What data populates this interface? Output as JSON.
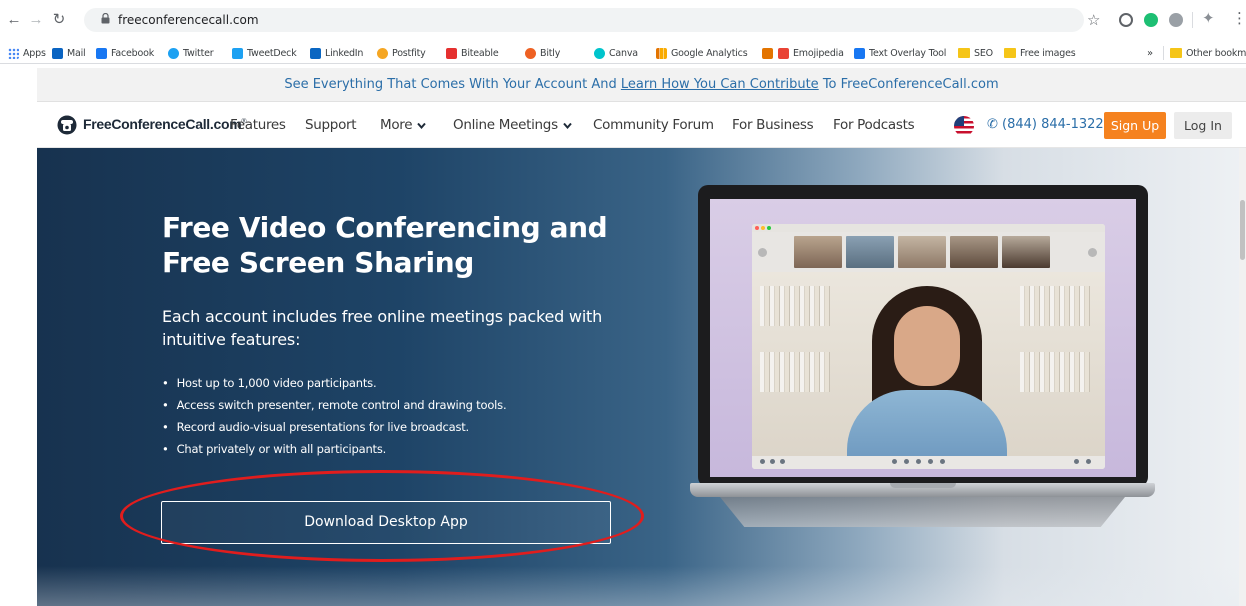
{
  "browser": {
    "url": "freeconferencecall.com",
    "bookmarks": [
      {
        "label": "Apps",
        "color": "#4285f4"
      },
      {
        "label": "Mail",
        "color": "#0a64c2"
      },
      {
        "label": "Facebook",
        "color": "#1877f2"
      },
      {
        "label": "Twitter",
        "color": "#1da1f2"
      },
      {
        "label": "TweetDeck",
        "color": "#1da1f2"
      },
      {
        "label": "LinkedIn",
        "color": "#0a66c2"
      },
      {
        "label": "Postfity",
        "color": "#f5a623"
      },
      {
        "label": "Biteable",
        "color": "#e5302f"
      },
      {
        "label": "Bitly",
        "color": "#ee6123"
      },
      {
        "label": "Canva",
        "color": "#00c4cc"
      },
      {
        "label": "Google Analytics",
        "color": "#f9ab00"
      },
      {
        "label": "",
        "color": "#e37400"
      },
      {
        "label": "Emojipedia",
        "color": "#e94335"
      },
      {
        "label": "Text Overlay Tool",
        "color": "#1877f2"
      },
      {
        "label": "SEO",
        "color": "#f5c518"
      },
      {
        "label": "Free images",
        "color": "#f5c518"
      }
    ],
    "more_bookmarks": "»",
    "other_bookmarks": "Other bookmarks"
  },
  "announcement": {
    "prefix": "See Everything That Comes With Your Account And ",
    "link": "Learn How You Can Contribute",
    "suffix": " To FreeConferenceCall.com"
  },
  "nav": {
    "logo": "FreeConferenceCall.com",
    "logo_mark": "®",
    "links": [
      "Features",
      "Support",
      "More",
      "Online Meetings",
      "Community Forum",
      "For Business",
      "For Podcasts"
    ],
    "phone": "(844) 844-1322",
    "signup": "Sign Up",
    "login": "Log In"
  },
  "hero": {
    "title": "Free Video Conferencing and Free Screen Sharing",
    "subtitle": "Each account includes free online meetings packed with intuitive features:",
    "features": [
      "Host up to 1,000 video participants.",
      "Access switch presenter, remote control and drawing tools.",
      "Record audio-visual presentations for live broadcast.",
      "Chat privately or with all participants."
    ],
    "cta": "Download Desktop App"
  },
  "colors": {
    "accent_orange": "#f5821f",
    "link_blue": "#2b6ea8",
    "annotation_red": "#e11d1d"
  }
}
